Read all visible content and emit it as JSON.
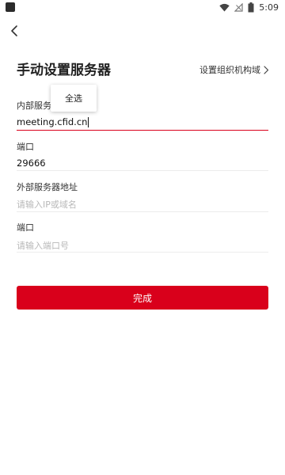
{
  "status_bar": {
    "time": "5:09",
    "icons": [
      "wifi-icon",
      "signal-icon",
      "battery-icon"
    ]
  },
  "header": {
    "back_icon": "chevron-left-icon"
  },
  "page": {
    "title": "手动设置服务器",
    "org_link_label": "设置组织机构域",
    "org_link_icon": "chevron-right-icon"
  },
  "context_menu": {
    "select_all_label": "全选"
  },
  "form": {
    "internal_server": {
      "label": "内部服务器地址",
      "value": "meeting.cfid.cn"
    },
    "internal_port": {
      "label": "端口",
      "value": "29666"
    },
    "external_server": {
      "label": "外部服务器地址",
      "placeholder": "请输入IP或域名",
      "value": ""
    },
    "external_port": {
      "label": "端口",
      "placeholder": "请输入端口号",
      "value": ""
    }
  },
  "done_button": {
    "label": "完成"
  },
  "colors": {
    "accent": "#d9001b",
    "text": "#222222",
    "placeholder": "#b8b8b8",
    "divider": "#ececec"
  }
}
